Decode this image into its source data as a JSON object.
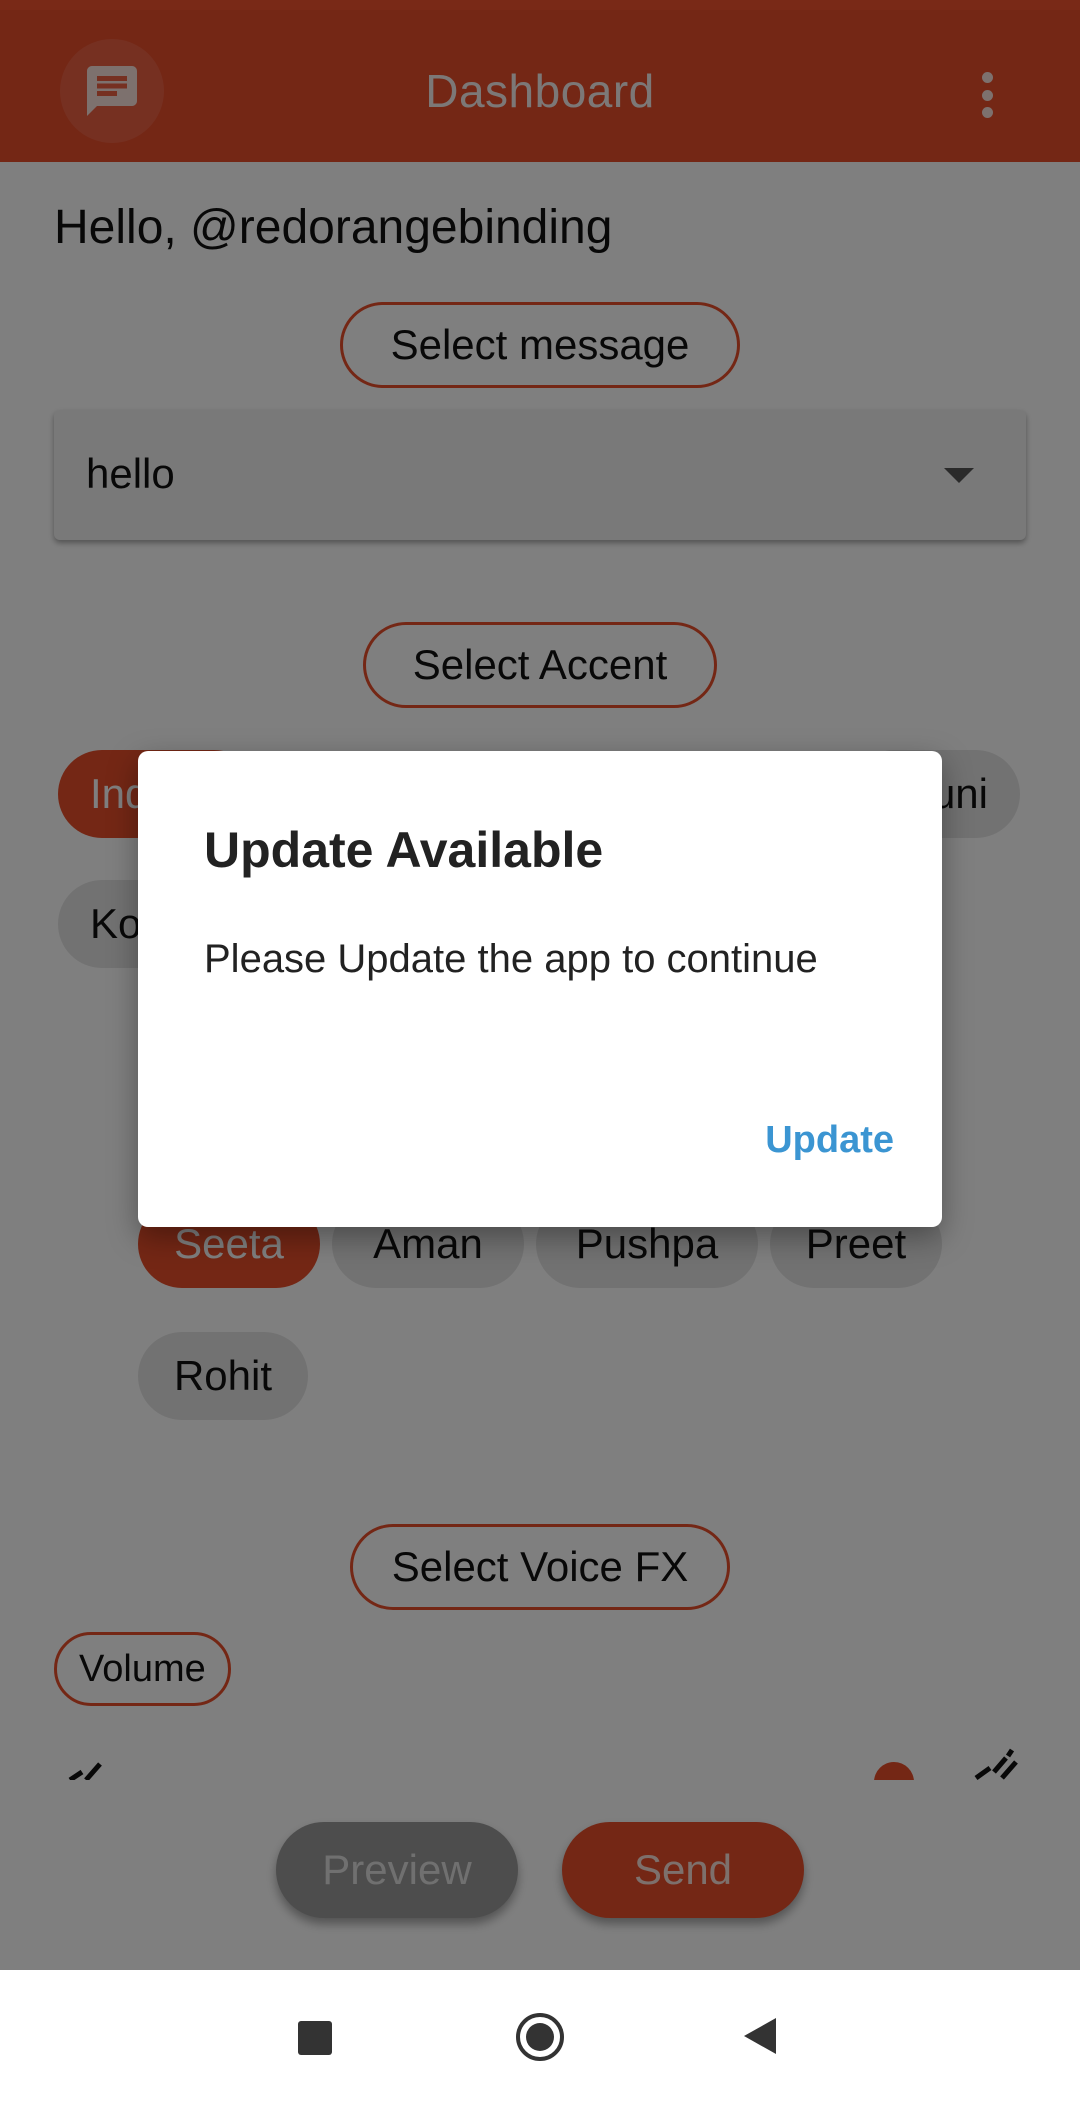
{
  "app_bar": {
    "title": "Dashboard",
    "chat_icon": "chat-bubble-icon",
    "menu_icon": "more-vert-icon"
  },
  "greeting": "Hello, @redorangebinding",
  "message_section": {
    "label": "Select message",
    "selected_value": "hello"
  },
  "accent_section": {
    "label": "Select Accent",
    "visible_chips": [
      {
        "label": "Ind",
        "selected": true
      },
      {
        "label": "uni",
        "selected": false
      },
      {
        "label": "Ko",
        "selected": false
      }
    ]
  },
  "voice_section": {
    "chips": [
      {
        "label": "Seeta",
        "selected": true
      },
      {
        "label": "Aman",
        "selected": false
      },
      {
        "label": "Pushpa",
        "selected": false
      },
      {
        "label": "Preet",
        "selected": false
      },
      {
        "label": "Rohit",
        "selected": false
      }
    ]
  },
  "voice_fx_section": {
    "label": "Select Voice FX"
  },
  "volume": {
    "label": "Volume"
  },
  "actions": {
    "preview_label": "Preview",
    "send_label": "Send"
  },
  "dialog": {
    "title": "Update Available",
    "body": "Please Update the app to continue",
    "action_label": "Update"
  },
  "nav_bar": {
    "recents_icon": "square-icon",
    "home_icon": "circle-home-icon",
    "back_icon": "triangle-back-icon"
  },
  "colors": {
    "accent": "#e94e2b",
    "dialog_action": "#3b95d2"
  }
}
